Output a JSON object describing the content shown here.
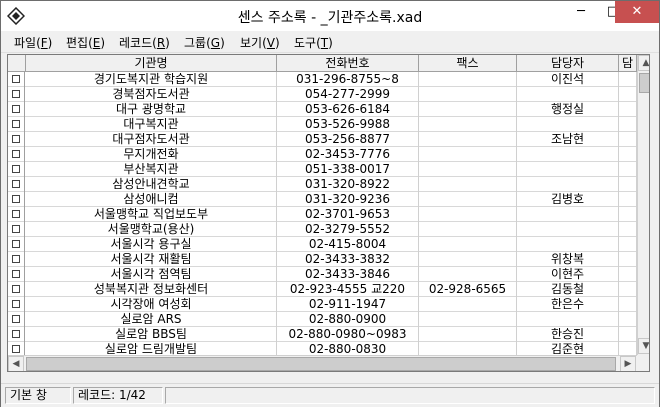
{
  "window": {
    "title": "센스 주소록 - _기관주소록.xad",
    "minimize": "─",
    "maximize": "□",
    "close": "✕"
  },
  "menu": [
    {
      "label": "파일",
      "key": "F"
    },
    {
      "label": "편집",
      "key": "E"
    },
    {
      "label": "레코드",
      "key": "R"
    },
    {
      "label": "그룹",
      "key": "G"
    },
    {
      "label": "보기",
      "key": "V"
    },
    {
      "label": "도구",
      "key": "T"
    }
  ],
  "table": {
    "columns": [
      "기관명",
      "전화번호",
      "팩스",
      "담당자",
      "담"
    ],
    "rows": [
      [
        "경기도복지관 학습지원",
        "031-296-8755~8",
        "",
        "이진석"
      ],
      [
        "경북점자도서관",
        "054-277-2999",
        "",
        ""
      ],
      [
        "대구 광명학교",
        "053-626-6184",
        "",
        "행정실"
      ],
      [
        "대구복지관",
        "053-526-9988",
        "",
        ""
      ],
      [
        "대구점자도서관",
        "053-256-8877",
        "",
        "조남현"
      ],
      [
        "무지개전화",
        "02-3453-7776",
        "",
        ""
      ],
      [
        "부산복지관",
        "051-338-0017",
        "",
        ""
      ],
      [
        "삼성안내견학교",
        "031-320-8922",
        "",
        ""
      ],
      [
        "삼성애니컴",
        "031-320-9236",
        "",
        "김병호"
      ],
      [
        "서울맹학교 직업보도부",
        "02-3701-9653",
        "",
        ""
      ],
      [
        "서울맹학교(용산)",
        "02-3279-5552",
        "",
        ""
      ],
      [
        "서울시각 용구실",
        "02-415-8004",
        "",
        ""
      ],
      [
        "서울시각 재활팀",
        "02-3433-3832",
        "",
        "위창복"
      ],
      [
        "서울시각 점역팀",
        "02-3433-3846",
        "",
        "이현주"
      ],
      [
        "성북복지관 정보화센터",
        "02-923-4555 교220",
        "02-928-6565",
        "김동철"
      ],
      [
        "시각장애 여성회",
        "02-911-1947",
        "",
        "한은수"
      ],
      [
        "실로암 ARS",
        "02-880-0900",
        "",
        ""
      ],
      [
        "실로암 BBS팀",
        "02-880-0980~0983",
        "",
        "한승진"
      ],
      [
        "실로암 드림개발팀",
        "02-880-0830",
        "",
        "김준현"
      ]
    ]
  },
  "status": {
    "mode": "기본 창",
    "record": "레코드: 1/42"
  },
  "icons": {
    "app": "diamond-logo-icon",
    "scroll_up": "▲",
    "scroll_down": "▼",
    "scroll_left": "◀",
    "scroll_right": "▶"
  }
}
